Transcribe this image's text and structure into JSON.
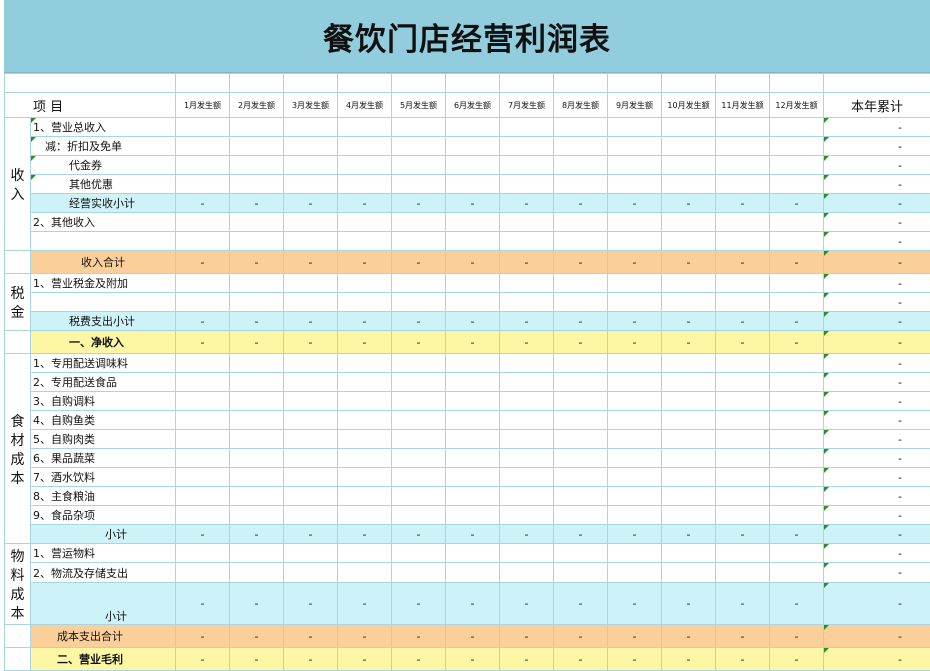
{
  "title": "餐饮门店经营利润表",
  "header": {
    "item": "项    目",
    "months": [
      "1月发生额",
      "2月发生额",
      "3月发生额",
      "4月发生额",
      "5月发生额",
      "6月发生额",
      "7月发生额",
      "8月发生额",
      "9月发生额",
      "10月发生额",
      "11月发生额",
      "12月发生额"
    ],
    "total": "本年累计"
  },
  "dash": "-",
  "sections": [
    {
      "category": "收入",
      "rows": [
        {
          "label": "1、营业总收入",
          "type": "normal",
          "indent": 0
        },
        {
          "label": "减：折扣及免单",
          "type": "normal",
          "indent": 1
        },
        {
          "label": "代金券",
          "type": "normal",
          "indent": 3
        },
        {
          "label": "其他优惠",
          "type": "normal",
          "indent": 3
        },
        {
          "label": "经营实收小计",
          "type": "sub",
          "indent": 3
        },
        {
          "label": "2、其他收入",
          "type": "normal",
          "indent": 0
        },
        {
          "label": "",
          "type": "normal",
          "indent": 0
        }
      ]
    },
    {
      "category": "",
      "rows": [
        {
          "label": "收入合计",
          "type": "orange",
          "indent": 4
        }
      ]
    },
    {
      "category": "税金",
      "rows": [
        {
          "label": "1、营业税金及附加",
          "type": "normal",
          "indent": 0
        },
        {
          "label": "",
          "type": "normal",
          "indent": 0
        },
        {
          "label": "税费支出小计",
          "type": "sub",
          "indent": 3
        }
      ]
    },
    {
      "category": "",
      "rows": [
        {
          "label": "一、净收入",
          "type": "yellow",
          "indent": 3,
          "bold": true
        }
      ]
    },
    {
      "category": "食材成本",
      "rows": [
        {
          "label": "1、专用配送调味料",
          "type": "normal",
          "indent": 0
        },
        {
          "label": "2、专用配送食品",
          "type": "normal",
          "indent": 0
        },
        {
          "label": "3、自购调料",
          "type": "normal",
          "indent": 0
        },
        {
          "label": "4、自购鱼类",
          "type": "normal",
          "indent": 0
        },
        {
          "label": "5、自购肉类",
          "type": "normal",
          "indent": 0
        },
        {
          "label": "6、果品蔬菜",
          "type": "normal",
          "indent": 0
        },
        {
          "label": "7、酒水饮料",
          "type": "normal",
          "indent": 0
        },
        {
          "label": "8、主食粮油",
          "type": "normal",
          "indent": 0
        },
        {
          "label": "9、食品杂项",
          "type": "normal",
          "indent": 0
        },
        {
          "label": "小计",
          "type": "sub",
          "indent": 6
        }
      ]
    },
    {
      "category": "物料成本",
      "rows": [
        {
          "label": "1、营运物料",
          "type": "normal",
          "indent": 0
        },
        {
          "label": "2、物流及存储支出",
          "type": "normal",
          "indent": 0
        },
        {
          "label": "小计",
          "type": "subtall",
          "indent": 6
        }
      ]
    },
    {
      "category": "",
      "rows": [
        {
          "label": "成本支出合计",
          "type": "orange",
          "indent": 2
        }
      ]
    },
    {
      "category": "",
      "rows": [
        {
          "label": "二、营业毛利",
          "type": "yellow",
          "indent": 2,
          "bold": true
        }
      ]
    }
  ]
}
